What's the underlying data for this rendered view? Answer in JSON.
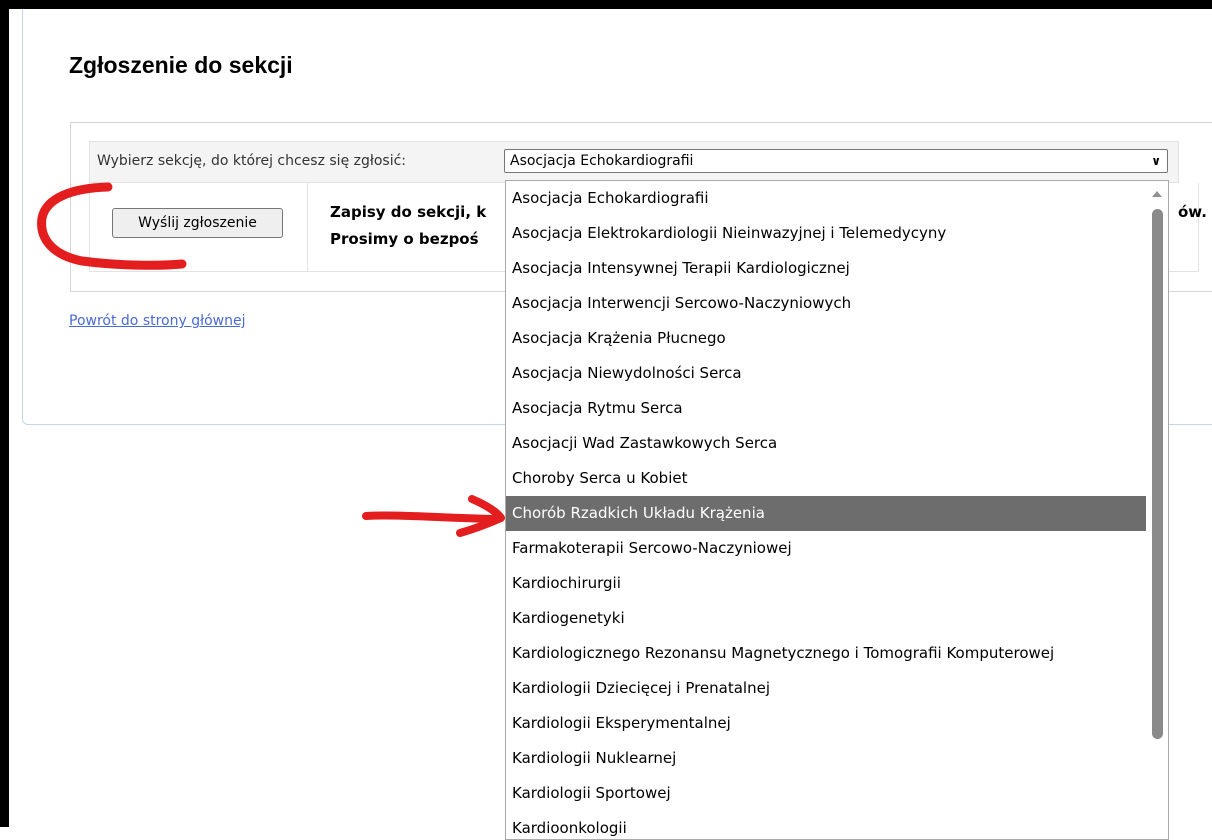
{
  "page": {
    "title": "Zgłoszenie do sekcji"
  },
  "form": {
    "select_label": "Wybierz sekcję, do której chcesz się zgłosić:",
    "select_value": "Asocjacja Echokardiografii",
    "submit_label": "Wyślij zgłoszenie",
    "info_line1": "Zapisy do sekcji, k",
    "info_line2": "Prosimy o bezpoś",
    "info_tail": "ów."
  },
  "back_link": "Powrót do strony głównej",
  "dropdown": {
    "options": [
      "Asocjacja Echokardiografii",
      "Asocjacja Elektrokardiologii Nieinwazyjnej i Telemedycyny",
      "Asocjacja Intensywnej Terapii Kardiologicznej",
      "Asocjacja Interwencji Sercowo-Naczyniowych",
      "Asocjacja Krążenia Płucnego",
      "Asocjacja Niewydolności Serca",
      "Asocjacja Rytmu Serca",
      "Asocjacji Wad Zastawkowych Serca",
      "Choroby Serca u Kobiet",
      "Chorób Rzadkich Układu Krążenia",
      "Farmakoterapii Sercowo-Naczyniowej",
      "Kardiochirurgii",
      "Kardiogenetyki",
      "Kardiologicznego Rezonansu Magnetycznego i Tomografii Komputerowej",
      "Kardiologii Dziecięcej i Prenatalnej",
      "Kardiologii Eksperymentalnej",
      "Kardiologii Nuklearnej",
      "Kardiologii Sportowej",
      "Kardioonkologii"
    ],
    "highlighted": "Chorób Rzadkich Układu Krążenia"
  },
  "colors": {
    "annotation": "#e41e1e",
    "highlight": "#6d6d6d",
    "link": "#4a6ad6"
  }
}
